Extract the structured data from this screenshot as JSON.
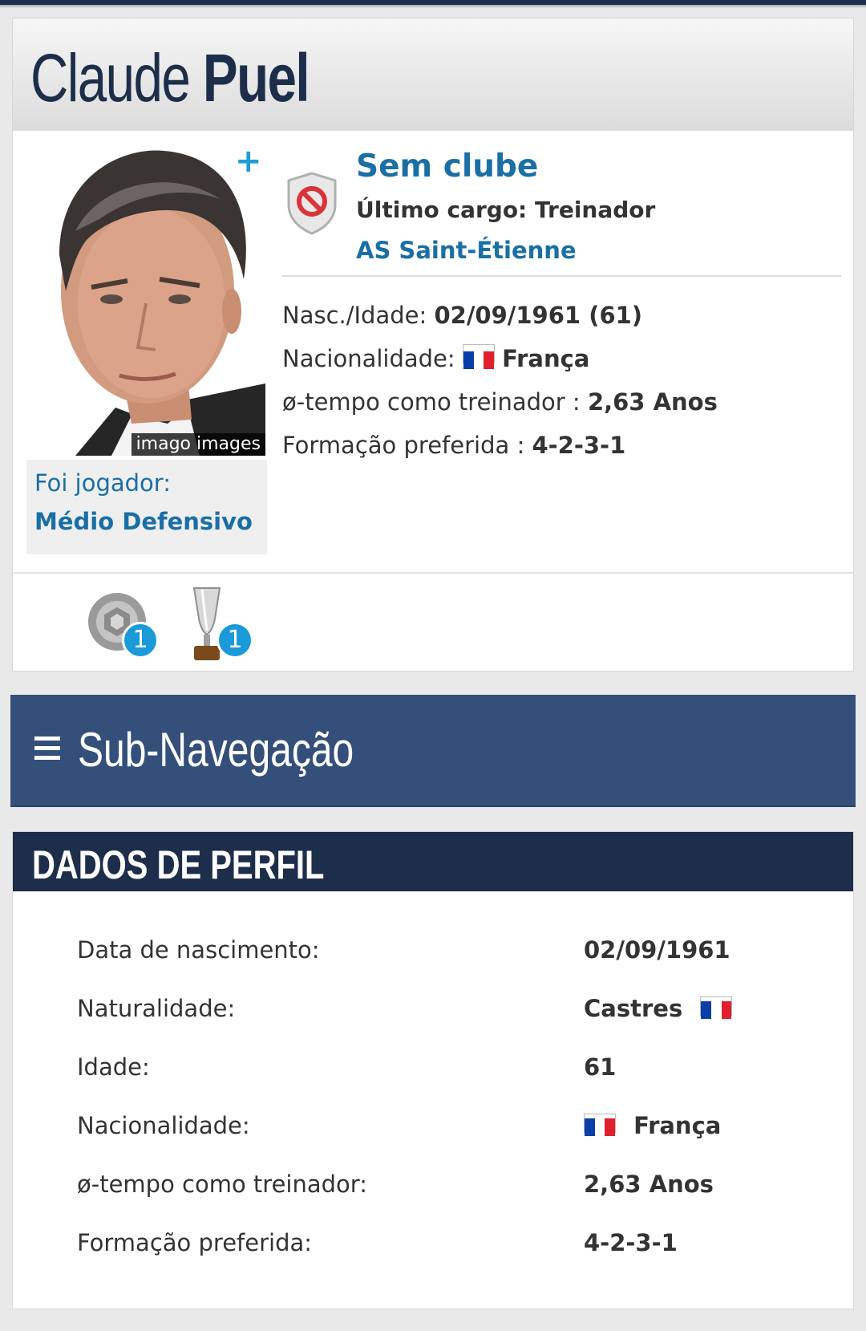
{
  "header": {
    "first_name": "Claude",
    "last_name": "Puel",
    "photo_credit": "imago images"
  },
  "club": {
    "status": "Sem clube",
    "last_role": "Último cargo: Treinador",
    "last_club": "AS Saint-Étienne"
  },
  "former_player": {
    "label": "Foi jogador:",
    "position": "Médio Defensivo"
  },
  "info": {
    "birth_label": "Nasc./Idade:",
    "birth_value": "02/09/1961 (61)",
    "nationality_label": "Nacionalidade:",
    "nationality_value": "França",
    "avg_tenure_label": "ø-tempo como treinador :",
    "avg_tenure_value": "2,63 Anos",
    "formation_label": "Formação preferida :",
    "formation_value": "4-2-3-1"
  },
  "trophies": [
    {
      "icon": "league-trophy-icon",
      "count": "1"
    },
    {
      "icon": "cup-trophy-icon",
      "count": "1"
    }
  ],
  "subnav": {
    "label": "Sub-Navegação"
  },
  "profile": {
    "title": "DADOS DE PERFIL",
    "rows": [
      {
        "label": "Data de nascimento:",
        "value": "02/09/1961"
      },
      {
        "label": "Naturalidade:",
        "value": "Castres"
      },
      {
        "label": "Idade:",
        "value": "61"
      },
      {
        "label": "Nacionalidade:",
        "value": "França"
      },
      {
        "label": "ø-tempo como treinador:",
        "value": "2,63 Anos"
      },
      {
        "label": "Formação preferida:",
        "value": "4-2-3-1"
      }
    ]
  },
  "colors": {
    "primary_navy": "#1d2e4a",
    "subnav_blue": "#34507a",
    "link_blue": "#1a6fa5",
    "badge_blue": "#1a9ad9",
    "flag_blue": "#0a3fa8",
    "flag_red": "#e0202c"
  }
}
